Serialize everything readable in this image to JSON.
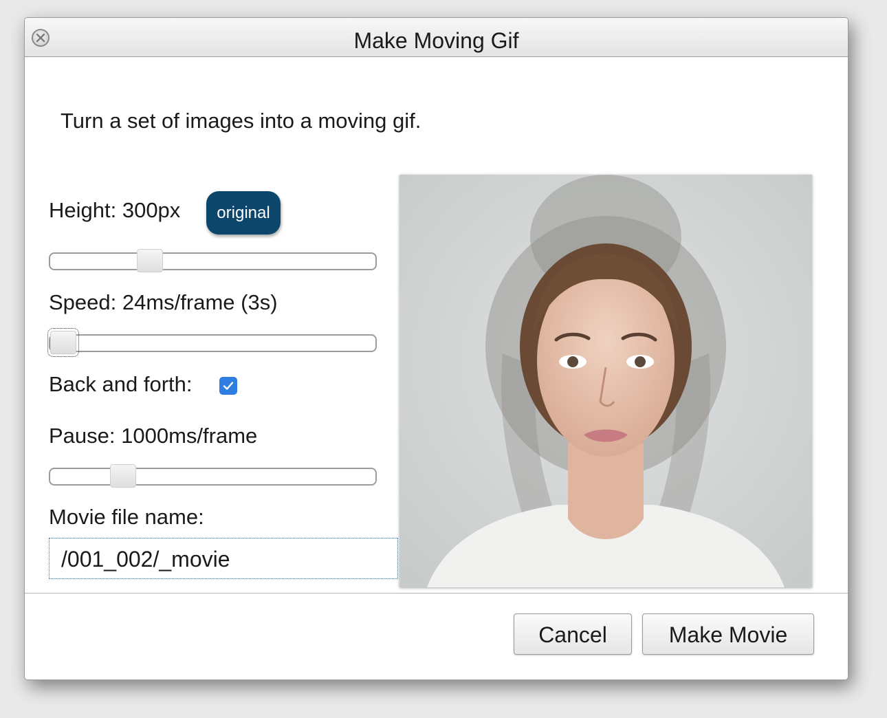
{
  "dialog": {
    "title": "Make Moving Gif",
    "intro": "Turn a set of images into a moving gif."
  },
  "height": {
    "label": "Height: 300px",
    "original_button": "original",
    "slider_fraction": 0.29
  },
  "speed": {
    "label": "Speed: 24ms/frame (3s)",
    "slider_fraction": 0.0
  },
  "back_and_forth": {
    "label": "Back and forth:",
    "checked": true
  },
  "pause": {
    "label": "Pause: 1000ms/frame",
    "slider_fraction": 0.2
  },
  "filename": {
    "label": "Movie file name:",
    "value": "/001_002/_movie"
  },
  "buttons": {
    "cancel": "Cancel",
    "make_movie": "Make Movie"
  },
  "colors": {
    "original_button": "#0c466b",
    "checkbox": "#2f7de1"
  },
  "icons": {
    "close": "close-icon",
    "checkbox": "checkmark-icon"
  }
}
